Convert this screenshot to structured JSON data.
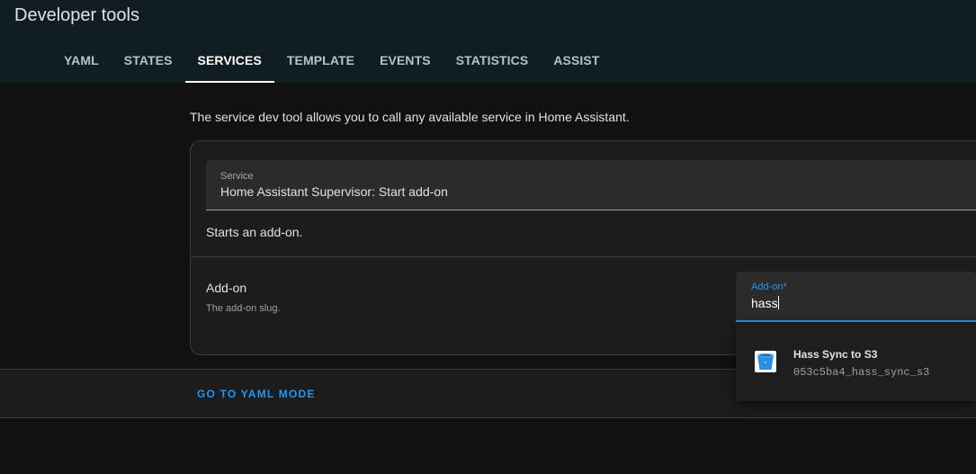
{
  "header": {
    "title": "Developer tools",
    "tabs": [
      {
        "label": "YAML",
        "active": false
      },
      {
        "label": "STATES",
        "active": false
      },
      {
        "label": "SERVICES",
        "active": true
      },
      {
        "label": "TEMPLATE",
        "active": false
      },
      {
        "label": "EVENTS",
        "active": false
      },
      {
        "label": "STATISTICS",
        "active": false
      },
      {
        "label": "ASSIST",
        "active": false
      }
    ]
  },
  "main": {
    "intro": "The service dev tool allows you to call any available service in Home Assistant.",
    "service": {
      "label": "Service",
      "value": "Home Assistant Supervisor: Start add-on",
      "description": "Starts an add-on."
    },
    "addon_field": {
      "name": "Add-on",
      "help": "The add-on slug.",
      "input_label": "Add-on*",
      "input_value": "hass"
    },
    "dropdown": {
      "items": [
        {
          "title": "Hass Sync to S3",
          "slug": "053c5ba4_hass_sync_s3",
          "icon": "s3-bucket-icon"
        }
      ]
    },
    "footer": {
      "yaml_mode_label": "GO TO YAML MODE"
    }
  },
  "colors": {
    "header_bg": "#101e24",
    "page_bg": "#111111",
    "card_bg": "#1c1c1c",
    "accent": "#2196f3"
  }
}
